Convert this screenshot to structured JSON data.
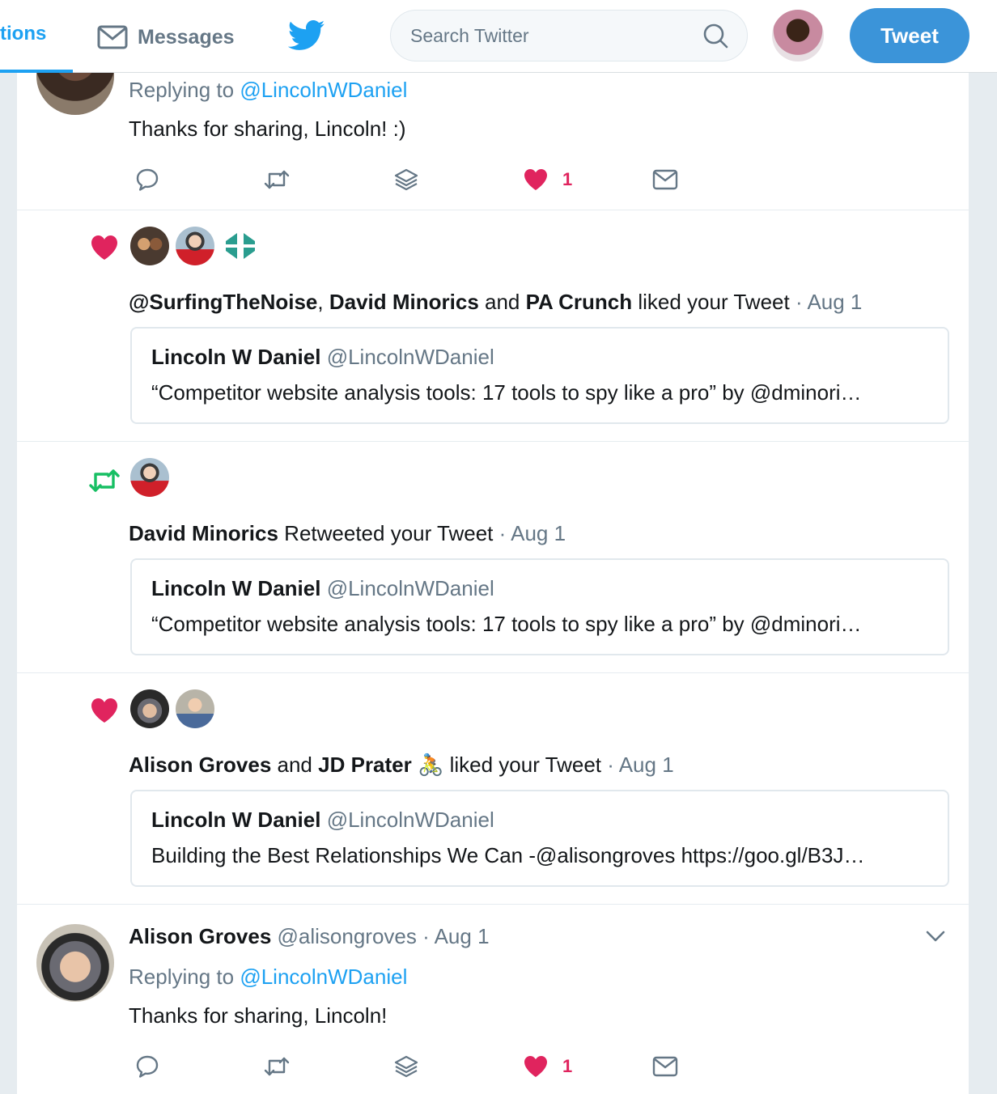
{
  "topbar": {
    "notifications_label": "tions",
    "messages_label": "Messages",
    "search_placeholder": "Search Twitter",
    "tweet_button": "Tweet"
  },
  "colors": {
    "brand_blue": "#1da1f2",
    "like_red": "#e0245e",
    "retweet_green": "#17bf63",
    "muted_gray": "#657786"
  },
  "items": {
    "reply1": {
      "replying_prefix": "Replying to",
      "replying_handle": "@LincolnWDaniel",
      "text": "Thanks for sharing, Lincoln! :)",
      "like_count": "1"
    },
    "like1": {
      "user1": "@SurfingTheNoise",
      "sep1": ",",
      "user2": "David Minorics",
      "and": "and",
      "user3": "PA Crunch",
      "action": "liked your Tweet",
      "dot": "·",
      "date": "Aug 1",
      "quote_name": "Lincoln W Daniel",
      "quote_handle": "@LincolnWDaniel",
      "quote_text": "“Competitor website analysis tools: 17 tools to spy like a pro” by @dminori…"
    },
    "retweet1": {
      "user1": "David Minorics",
      "action": "Retweeted your Tweet",
      "dot": "·",
      "date": "Aug 1",
      "quote_name": "Lincoln W Daniel",
      "quote_handle": "@LincolnWDaniel",
      "quote_text": "“Competitor website analysis tools: 17 tools to spy like a pro” by @dminori…"
    },
    "like2": {
      "user1": "Alison Groves",
      "and": "and",
      "user2": "JD Prater",
      "emoji": "🚴",
      "action": "liked your Tweet",
      "dot": "·",
      "date": "Aug 1",
      "quote_name": "Lincoln W Daniel",
      "quote_handle": "@LincolnWDaniel",
      "quote_text": "Building the Best Relationships We Can -@alisongroves https://goo.gl/B3J…"
    },
    "reply2": {
      "name": "Alison Groves",
      "handle": "@alisongroves",
      "dot": "·",
      "date": "Aug 1",
      "replying_prefix": "Replying to",
      "replying_handle": "@LincolnWDaniel",
      "text": "Thanks for sharing, Lincoln!",
      "like_count": "1"
    }
  }
}
